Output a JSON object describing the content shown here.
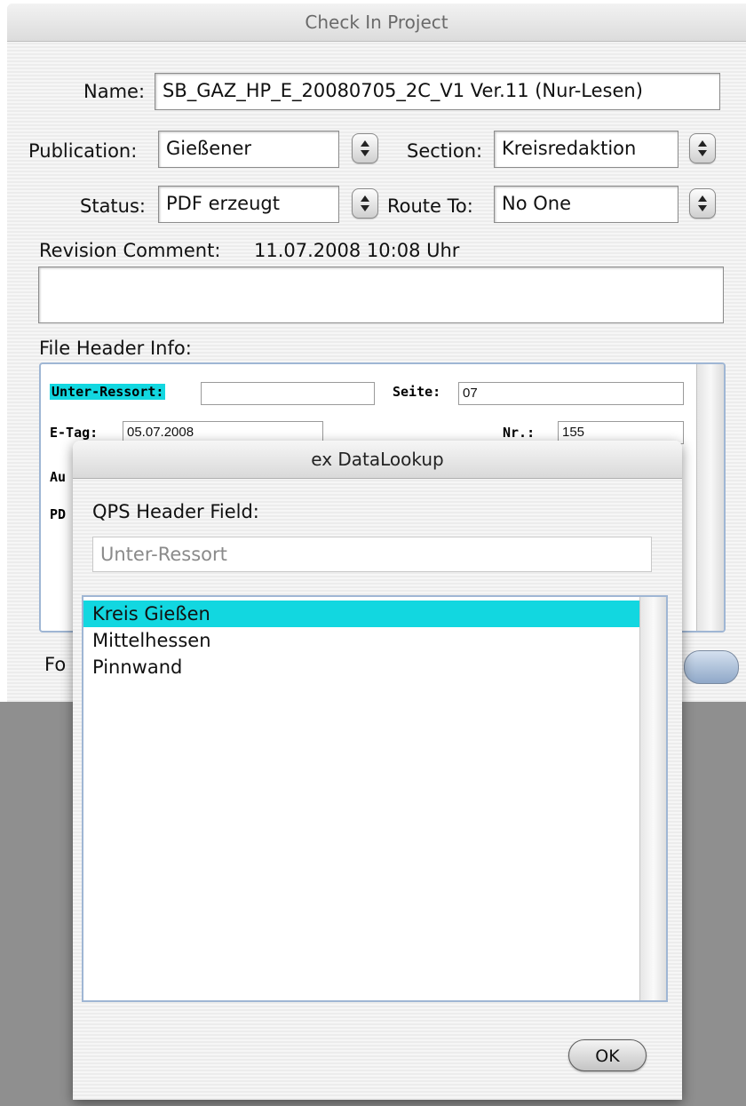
{
  "main_window": {
    "title": "Check In Project",
    "name_label": "Name:",
    "name_value": "SB_GAZ_HP_E_20080705_2C_V1 Ver.11 (Nur-Lesen)",
    "publication_label": "Publication:",
    "publication_value": "Gießener",
    "section_label": "Section:",
    "section_value": "Kreisredaktion",
    "status_label": "Status:",
    "status_value": "PDF erzeugt",
    "route_label": "Route To:",
    "route_value": "No One",
    "revision_label": "Revision Comment:",
    "revision_value": "11.07.2008  10:08 Uhr",
    "revision_text": "",
    "file_header_label": "File Header Info:",
    "bottom_label_partial": "Fo"
  },
  "file_header": {
    "unter_ressort_label": "Unter-Ressort:",
    "unter_ressort_value": "",
    "seite_label": "Seite:",
    "seite_value": "07",
    "etag_label": "E-Tag:",
    "etag_value": "05.07.2008",
    "nr_label": "Nr.:",
    "nr_value": "155",
    "au_label_partial": "Au",
    "pd_label_partial": "PD"
  },
  "lookup_dialog": {
    "title": "ex DataLookup",
    "field_label": "QPS Header Field:",
    "field_value": "Unter-Ressort",
    "items": [
      "Kreis Gießen",
      "Mittelhessen",
      "Pinnwand"
    ],
    "selected_index": 0,
    "ok_label": "OK"
  },
  "colors": {
    "highlight": "#12d7e0",
    "focus_border": "#9fb6d4",
    "backdrop": "#8f8f8f"
  }
}
